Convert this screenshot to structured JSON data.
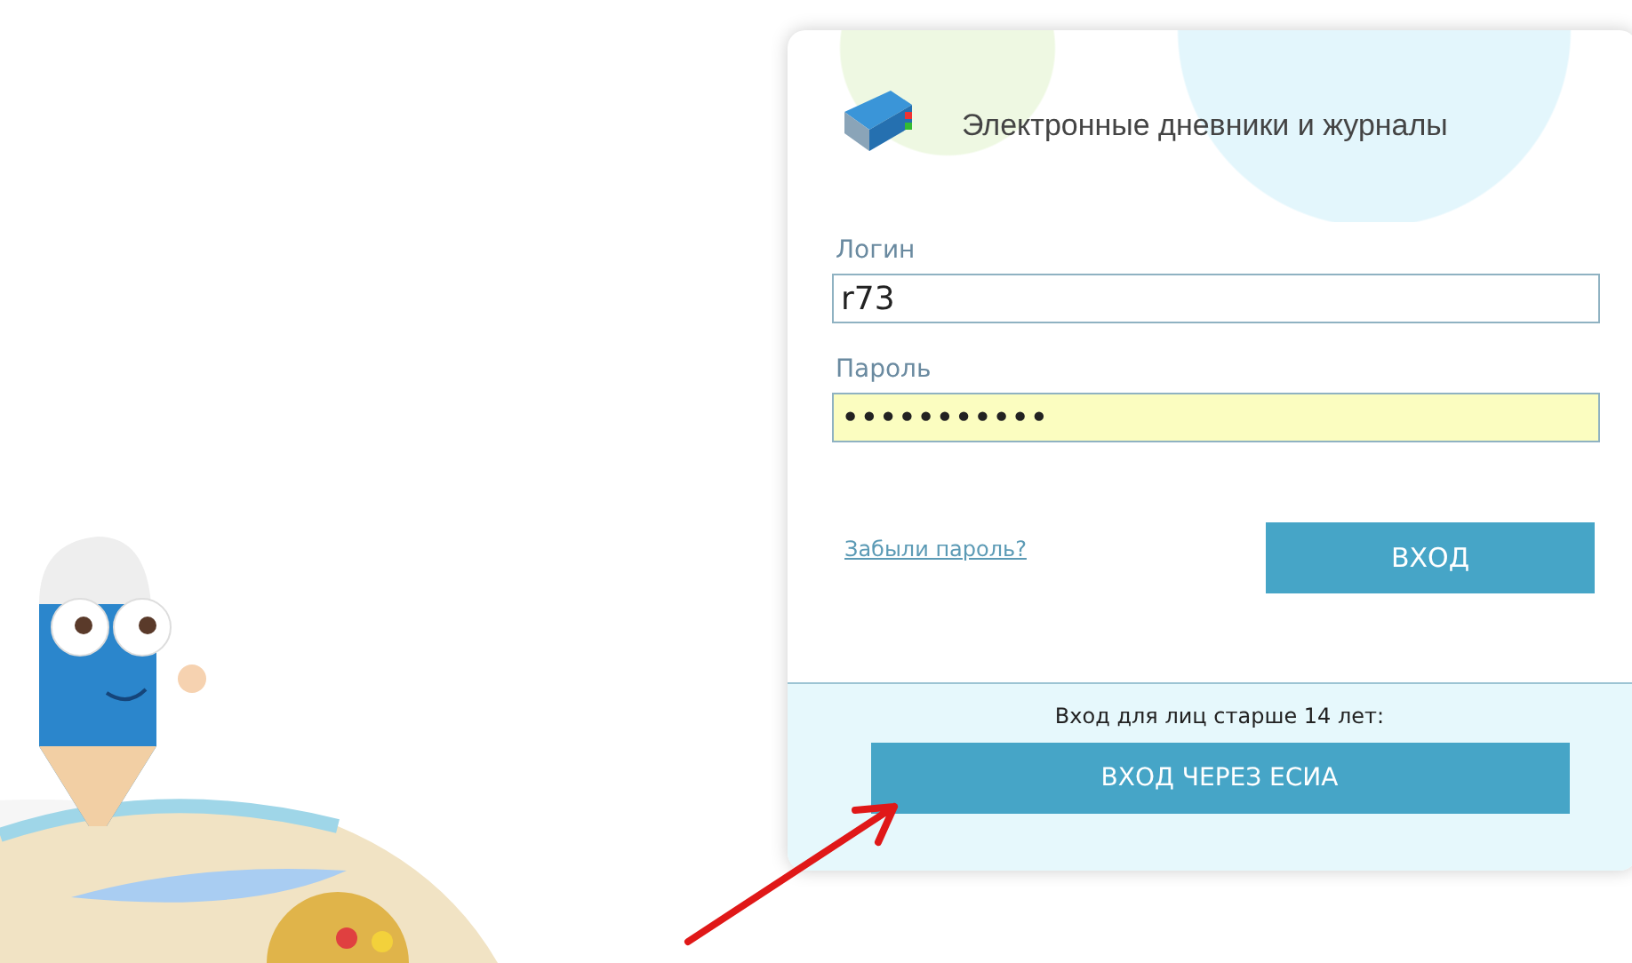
{
  "header": {
    "title": "Электронные дневники и журналы"
  },
  "login": {
    "label": "Логин",
    "value": "r73"
  },
  "password": {
    "label": "Пароль",
    "value": "•••••••••••",
    "autofilled": true
  },
  "forgot_link": "Забыли пароль?",
  "login_button": "ВХОД",
  "esia": {
    "note": "Вход для лиц старше 14 лет:",
    "button": "ВХОД ЧЕРЕЗ ЕСИА"
  }
}
